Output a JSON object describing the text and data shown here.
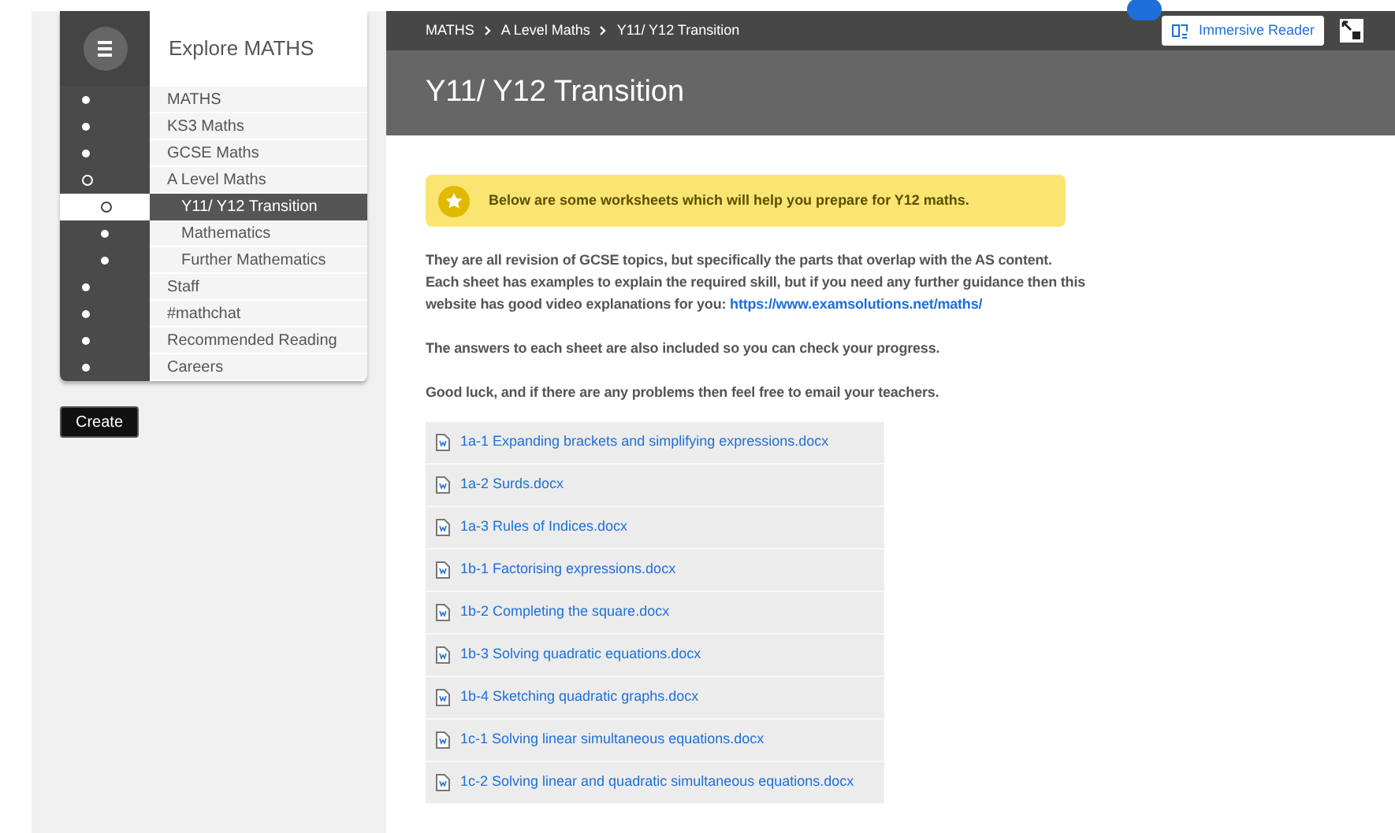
{
  "sidebar": {
    "title": "Explore MATHS",
    "items": [
      {
        "label": "MATHS",
        "selected": false,
        "expanded": false
      },
      {
        "label": "KS3 Maths",
        "selected": false,
        "expanded": false
      },
      {
        "label": "GCSE Maths",
        "selected": false,
        "expanded": false
      },
      {
        "label": "A Level Maths",
        "selected": false,
        "expanded": true,
        "children": [
          {
            "label": "Y11/ Y12 Transition",
            "selected": true,
            "expanded": false
          },
          {
            "label": "Mathematics",
            "selected": false,
            "expanded": false
          },
          {
            "label": "Further Mathematics",
            "selected": false,
            "expanded": false
          }
        ]
      },
      {
        "label": "Staff",
        "selected": false,
        "expanded": false
      },
      {
        "label": "#mathchat",
        "selected": false,
        "expanded": false
      },
      {
        "label": "Recommended Reading",
        "selected": false,
        "expanded": false
      },
      {
        "label": "Careers",
        "selected": false,
        "expanded": false
      }
    ],
    "create_button": "Create"
  },
  "breadcrumb": [
    "MATHS",
    "A Level Maths",
    "Y11/ Y12 Transition"
  ],
  "immersive_reader": "Immersive Reader",
  "page_title": "Y11/ Y12 Transition",
  "callout": "Below are some worksheets which will help you prepare for Y12 maths.",
  "paragraphs": [
    {
      "text": "They are all revision of GCSE topics, but specifically the parts that overlap with the AS content. Each sheet has examples to explain the required skill, but if you need any further guidance then this website has good video explanations for you:",
      "link": "https://www.examsolutions.net/maths/"
    },
    {
      "text": "The answers to each sheet are also included so you can check your progress."
    },
    {
      "text": "Good luck, and if there are any problems then feel free to email your teachers."
    }
  ],
  "files": [
    "1a-1 Expanding brackets and simplifying expressions.docx",
    "1a-2 Surds.docx",
    "1a-3 Rules of Indices.docx",
    "1b-1 Factorising expressions.docx",
    "1b-2 Completing the square.docx",
    "1b-3 Solving quadratic equations.docx",
    "1b-4 Sketching quadratic graphs.docx",
    "1c-1 Solving linear simultaneous equations.docx",
    "1c-2 Solving linear and quadratic simultaneous equations.docx"
  ]
}
